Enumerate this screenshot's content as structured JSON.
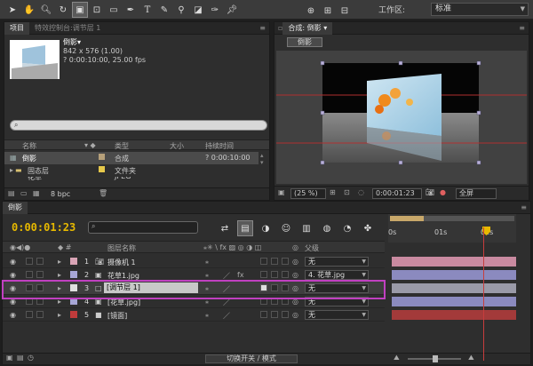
{
  "toolbar": {
    "workspace_label": "工作区:",
    "workspace_value": "标准",
    "tools": [
      "selection-tool",
      "hand-tool",
      "zoom-tool",
      "rotate-tool",
      "unified-camera-tool",
      "pan-behind-tool",
      "rectangle-mask-tool",
      "pen-tool",
      "text-tool",
      "brush-tool",
      "clone-stamp-tool",
      "eraser-tool",
      "roto-brush-tool",
      "puppet-pin-tool"
    ]
  },
  "project_panel": {
    "tab_project": "项目",
    "tab_effects": "特效控制台:调节层 1",
    "item_name": "倒影▾",
    "item_size": "842 x 576 (1.00)",
    "item_duration": "? 0:00:10:00, 25.00 fps",
    "columns": {
      "name": "名称",
      "type": "类型",
      "size": "大小",
      "duration": "持续时间"
    },
    "rows": [
      {
        "name": "倒影",
        "type": "合成",
        "size": "",
        "duration": "? 0:00:10:00",
        "color": "#b6a07a"
      },
      {
        "name": "固态层",
        "type": "文件夹",
        "size": "",
        "duration": "",
        "color": "#e6c84a"
      }
    ],
    "partial_row": "花草",
    "partial_type": "JPEG",
    "bpc": "8 bpc"
  },
  "comp_panel": {
    "tab": "合成: 倒影 ▾",
    "breadcrumb": "倒影",
    "zoom": "(25 %)",
    "timecode": "0:00:01:23",
    "view": "全屏"
  },
  "timeline": {
    "tab": "倒影",
    "current_time": "0:00:01:23",
    "search_placeholder": "",
    "col_source_name": "图层名称",
    "col_parent": "父级",
    "ruler_labels": [
      "0s",
      "01s",
      "02s"
    ],
    "layers": [
      {
        "num": "1",
        "name": "摄像机 1",
        "color": "#d9a4b5",
        "parent": "无",
        "bar_color": "#c98aa0",
        "icon": "camera-icon"
      },
      {
        "num": "2",
        "name": "花草1.jpg",
        "color": "#a7a6d6",
        "parent": "4. 花草.jpg",
        "bar_color": "#8b8abf",
        "icon": "image-icon"
      },
      {
        "num": "3",
        "name": "[调节层 1]",
        "color": "#e0e0e0",
        "parent": "无",
        "bar_color": "#9a9aa8",
        "icon": "adjustment-icon"
      },
      {
        "num": "4",
        "name": "[花草.jpg]",
        "color": "#a7a6d6",
        "parent": "无",
        "bar_color": "#8b8abf",
        "icon": "image-icon"
      },
      {
        "num": "5",
        "name": "[镜面]",
        "color": "#c03b3b",
        "parent": "无",
        "bar_color": "#a33a3a",
        "icon": "solid-icon"
      }
    ],
    "footer_label": "切换开关 / 模式"
  }
}
